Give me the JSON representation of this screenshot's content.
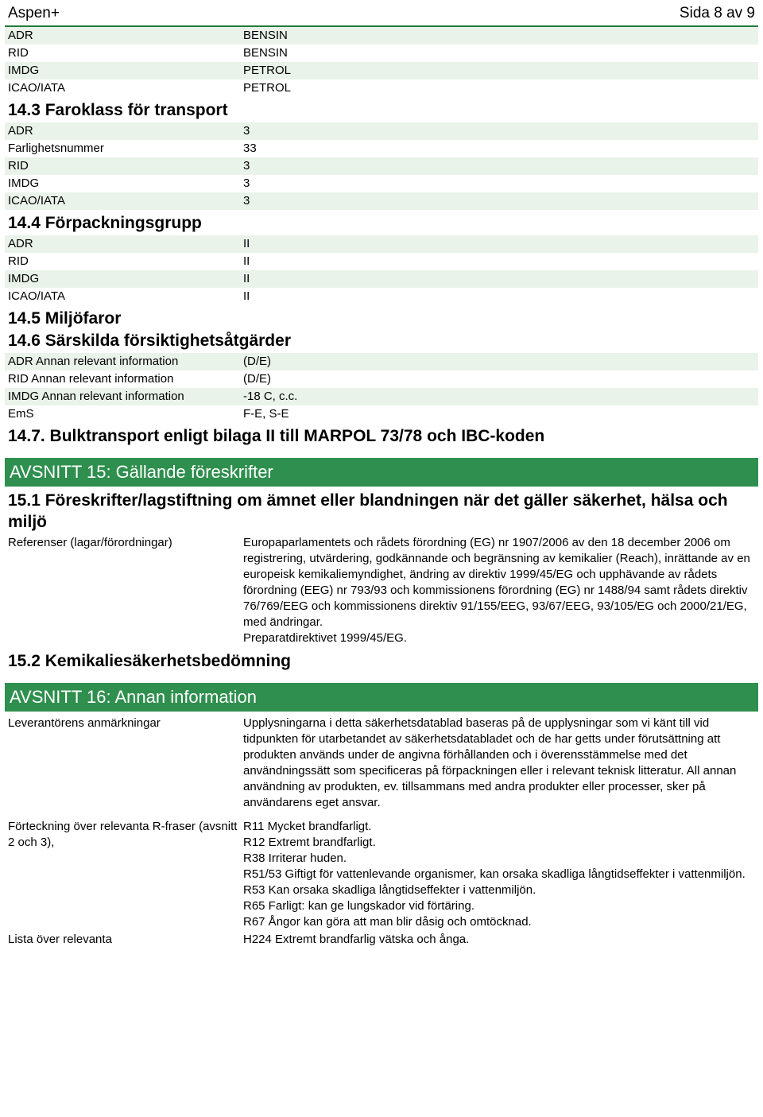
{
  "header": {
    "brand": "Aspen+",
    "page_label": "Sida 8 av 9"
  },
  "transport_names": [
    {
      "label": "ADR",
      "value": "BENSIN"
    },
    {
      "label": "RID",
      "value": "BENSIN"
    },
    {
      "label": "IMDG",
      "value": "PETROL"
    },
    {
      "label": "ICAO/IATA",
      "value": "PETROL"
    }
  ],
  "s14_3": {
    "title": "14.3 Faroklass för transport",
    "rows": [
      {
        "label": "ADR",
        "value": "3"
      },
      {
        "label": "Farlighetsnummer",
        "value": "33"
      },
      {
        "label": "RID",
        "value": "3"
      },
      {
        "label": "IMDG",
        "value": "3"
      },
      {
        "label": "ICAO/IATA",
        "value": "3"
      }
    ]
  },
  "s14_4": {
    "title": "14.4 Förpackningsgrupp",
    "rows": [
      {
        "label": "ADR",
        "value": "II"
      },
      {
        "label": "RID",
        "value": "II"
      },
      {
        "label": "IMDG",
        "value": "II"
      },
      {
        "label": "ICAO/IATA",
        "value": "II"
      }
    ]
  },
  "s14_5": {
    "title": "14.5 Miljöfaror"
  },
  "s14_6": {
    "title": "14.6 Särskilda försiktighetsåtgärder",
    "rows": [
      {
        "label": "ADR Annan relevant information",
        "value": "(D/E)"
      },
      {
        "label": "RID Annan relevant information",
        "value": "(D/E)"
      },
      {
        "label": "IMDG Annan relevant information",
        "value": "-18 C, c.c."
      },
      {
        "label": "EmS",
        "value": "F-E, S-E"
      }
    ]
  },
  "s14_7": {
    "title": "14.7. Bulktransport enligt bilaga II till MARPOL 73/78 och IBC-koden"
  },
  "section15": {
    "band": "AVSNITT 15: Gällande föreskrifter",
    "heading_15_1": "15.1 Föreskrifter/lagstiftning om ämnet eller blandningen när det gäller säkerhet, hälsa och miljö",
    "references_label": "Referenser (lagar/förordningar)",
    "references_text": "Europaparlamentets och rådets förordning (EG) nr 1907/2006 av den 18 december 2006 om registrering, utvärdering, godkännande och begränsning av kemikalier (Reach), inrättande av en europeisk kemikaliemyndighet, ändring av direktiv 1999/45/EG och upphävande av rådets förordning (EEG) nr 793/93 och kommissionens förordning (EG) nr 1488/94 samt rådets direktiv 76/769/EEG och kommissionens direktiv 91/155/EEG, 93/67/EEG, 93/105/EG och 2000/21/EG, med ändringar.",
    "references_text2": "Preparatdirektivet 1999/45/EG.",
    "heading_15_2": "15.2 Kemikaliesäkerhetsbedömning"
  },
  "section16": {
    "band": "AVSNITT 16: Annan information",
    "supplier_label": "Leverantörens anmärkningar",
    "supplier_text": "Upplysningarna i detta säkerhetsdatablad baseras på de upplysningar som vi känt till vid tidpunkten för utarbetandet av säkerhetsdatabladet och de har getts under förutsättning att produkten används under de angivna förhållanden och i överensstämmelse med det användningssätt som specificeras på förpackningen eller i relevant teknisk litteratur. All annan användning av produkten, ev. tillsammans med andra produkter eller processer, sker på användarens eget ansvar.",
    "r_phrases_label": "Förteckning över relevanta R-fraser (avsnitt 2 och 3),",
    "r_phrases": [
      "R11 Mycket brandfarligt.",
      "R12 Extremt brandfarligt.",
      "R38 Irriterar huden.",
      "R51/53 Giftigt för vattenlevande organismer, kan orsaka skadliga långtidseffekter i vattenmiljön.",
      "R53 Kan orsaka skadliga långtidseffekter i vattenmiljön.",
      "R65 Farligt: kan ge lungskador vid förtäring.",
      "R67 Ångor kan göra att man blir dåsig och omtöcknad."
    ],
    "h_phrases_label": "Lista över relevanta",
    "h_phrases": [
      "H224 Extremt brandfarlig vätska och ånga."
    ]
  }
}
